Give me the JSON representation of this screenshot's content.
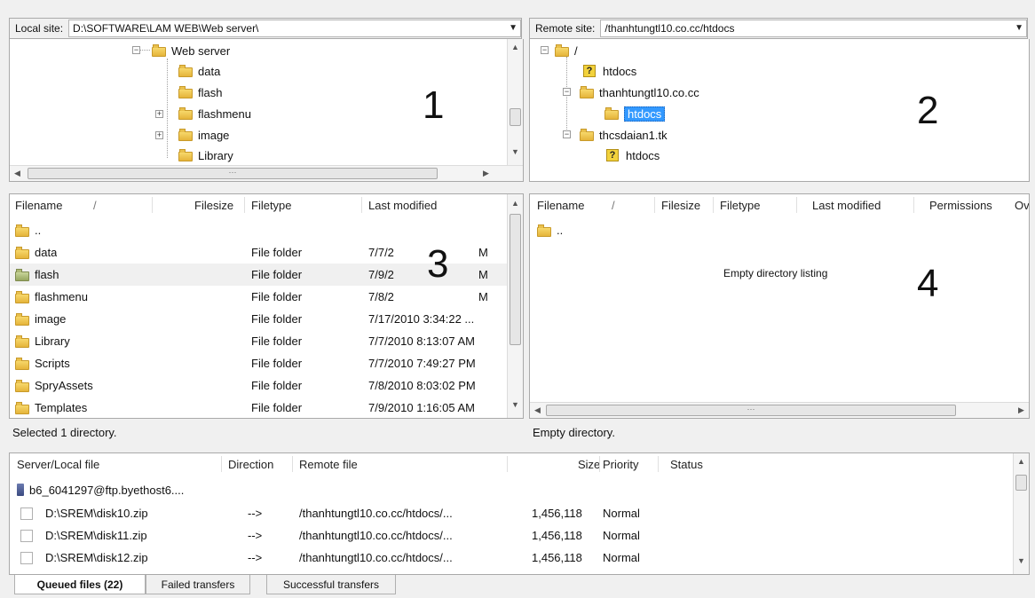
{
  "local_site": {
    "label": "Local site:",
    "path": "D:\\SOFTWARE\\LAM WEB\\Web server\\",
    "tree": [
      "Web server",
      "data",
      "flash",
      "flashmenu",
      "image",
      "Library"
    ]
  },
  "remote_site": {
    "label": "Remote site:",
    "path": "/thanhtungtl10.co.cc/htdocs",
    "tree": [
      "/",
      "htdocs",
      "thanhtungtl10.co.cc",
      "htdocs",
      "thcsdaian1.tk",
      "htdocs"
    ]
  },
  "annotations": [
    "1",
    "2",
    "3",
    "4"
  ],
  "local_list": {
    "headers": [
      "Filename",
      "/",
      "Filesize",
      "Filetype",
      "Last modified"
    ],
    "rows": [
      {
        "name": "..",
        "type": "",
        "modified": ""
      },
      {
        "name": "data",
        "type": "File folder",
        "modified": "7/7/2",
        "mod_tail": "M"
      },
      {
        "name": "flash",
        "type": "File folder",
        "modified": "7/9/2",
        "mod_tail": "M"
      },
      {
        "name": "flashmenu",
        "type": "File folder",
        "modified": "7/8/2",
        "mod_tail": "M"
      },
      {
        "name": "image",
        "type": "File folder",
        "modified": "7/17/2010 3:34:22 ..."
      },
      {
        "name": "Library",
        "type": "File folder",
        "modified": "7/7/2010 8:13:07 AM"
      },
      {
        "name": "Scripts",
        "type": "File folder",
        "modified": "7/7/2010 7:49:27 PM"
      },
      {
        "name": "SpryAssets",
        "type": "File folder",
        "modified": "7/8/2010 8:03:02 PM"
      },
      {
        "name": "Templates",
        "type": "File folder",
        "modified": "7/9/2010 1:16:05 AM"
      }
    ],
    "status": "Selected 1 directory."
  },
  "remote_list": {
    "headers": [
      "Filename",
      "/",
      "Filesize",
      "Filetype",
      "Last modified",
      "Permissions",
      "Ov"
    ],
    "rows": [
      {
        "name": ".."
      }
    ],
    "empty_text": "Empty directory listing",
    "status": "Empty directory."
  },
  "queue": {
    "headers": [
      "Server/Local file",
      "Direction",
      "Remote file",
      "Size",
      "Priority",
      "Status"
    ],
    "server": "b6_6041297@ftp.byethost6....",
    "rows": [
      {
        "local": "D:\\SREM\\disk10.zip",
        "direction": "-->",
        "remote": "/thanhtungtl10.co.cc/htdocs/...",
        "size": "1,456,118",
        "priority": "Normal"
      },
      {
        "local": "D:\\SREM\\disk11.zip",
        "direction": "-->",
        "remote": "/thanhtungtl10.co.cc/htdocs/...",
        "size": "1,456,118",
        "priority": "Normal"
      },
      {
        "local": "D:\\SREM\\disk12.zip",
        "direction": "-->",
        "remote": "/thanhtungtl10.co.cc/htdocs/...",
        "size": "1,456,118",
        "priority": "Normal"
      }
    ],
    "tabs": [
      "Queued files (22)",
      "Failed transfers",
      "Successful transfers"
    ]
  },
  "icons": {
    "folder": "folder-icon",
    "unknown_folder": "question-folder-icon",
    "server": "server-icon",
    "dropdown": "chevron-down-icon"
  }
}
